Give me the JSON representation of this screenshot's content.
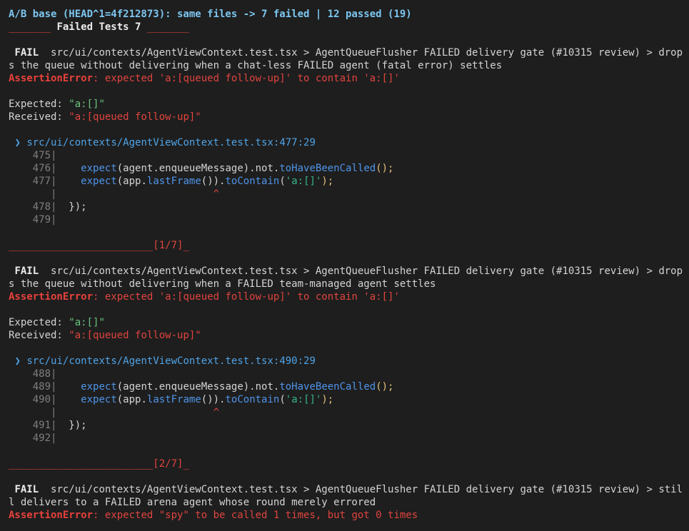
{
  "header": {
    "summary": "A/B base (HEAD^1=4f212873): same files -> 7 failed | 12 passed (19)",
    "failed_rule_left": "_______",
    "failed_title": " Failed Tests 7 ",
    "failed_rule_right": "_______"
  },
  "failures": [
    {
      "badge": "FAIL",
      "title_line1": "src/ui/contexts/AgentViewContext.test.tsx > AgentQueueFlusher FAILED delivery gate (#10315 review) > drop",
      "title_line2": "s the queue without delivering when a chat-less FAILED agent (fatal error) settles",
      "error_name": "AssertionError",
      "error_msg": ": expected 'a:[queued follow-up]' to contain 'a:[]'",
      "expected_label": "Expected: ",
      "expected_value": "\"a:[]\"",
      "received_label": "Received: ",
      "received_value": "\"a:[queued follow-up]\"",
      "location": "src/ui/contexts/AgentViewContext.test.tsx:477:29",
      "code": {
        "l1_no": "475",
        "l2_no": "476",
        "l3_no": "477",
        "l5_no": "478",
        "l6_no": "479"
      },
      "footer_rule": "________________________",
      "footer_counter": "[1/7]",
      "footer_tail": "_"
    },
    {
      "badge": "FAIL",
      "title_line1": "src/ui/contexts/AgentViewContext.test.tsx > AgentQueueFlusher FAILED delivery gate (#10315 review) > drop",
      "title_line2": "s the queue without delivering when a FAILED team-managed agent settles",
      "error_name": "AssertionError",
      "error_msg": ": expected 'a:[queued follow-up]' to contain 'a:[]'",
      "expected_label": "Expected: ",
      "expected_value": "\"a:[]\"",
      "received_label": "Received: ",
      "received_value": "\"a:[queued follow-up]\"",
      "location": "src/ui/contexts/AgentViewContext.test.tsx:490:29",
      "code": {
        "l1_no": "488",
        "l2_no": "489",
        "l3_no": "490",
        "l5_no": "491",
        "l6_no": "492"
      },
      "footer_rule": "________________________",
      "footer_counter": "[2/7]",
      "footer_tail": "_"
    },
    {
      "badge": "FAIL",
      "title_line1": "src/ui/contexts/AgentViewContext.test.tsx > AgentQueueFlusher FAILED delivery gate (#10315 review) > stil",
      "title_line2": "l delivers to a FAILED arena agent whose round merely errored",
      "error_name": "AssertionError",
      "error_msg": ": expected \"spy\" to be called 1 times, but got 0 times"
    }
  ],
  "code_tokens": {
    "indent": "    ",
    "expect": "expect",
    "agent_arg": "(agent.enqueueMessage).not.",
    "not_called": "toHaveBeenCalled",
    "close1": "();",
    "app_arg": "(app.",
    "last_frame": "lastFrame",
    "paren_dot": "()).",
    "to_contain": "toContain",
    "open_paren": "(",
    "str_arg": "'a:[]'",
    "close2": ");",
    "caret": "^",
    "close_block": "  });",
    "pipe": "|",
    "chevron": "❯"
  }
}
